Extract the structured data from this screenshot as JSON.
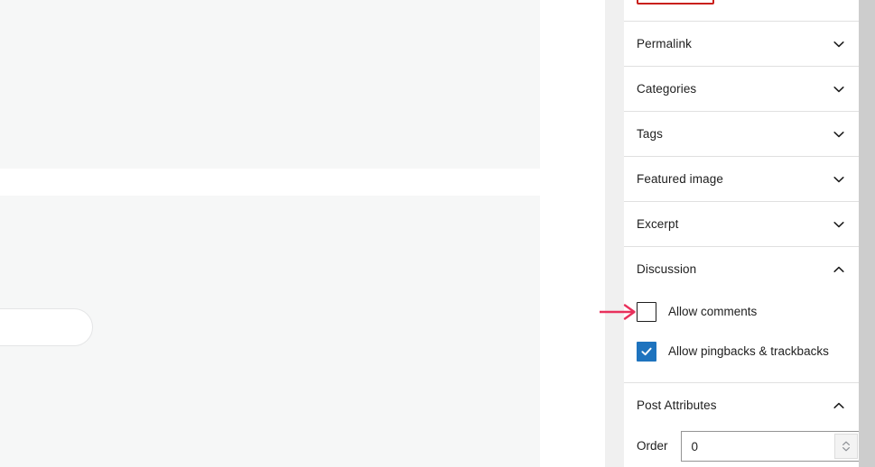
{
  "editor": {
    "canvas_blocks": [
      "content-placeholder-top",
      "content-placeholder-bottom"
    ],
    "pill_element": ""
  },
  "sidebar": {
    "highlighted_button_label": "",
    "sections": [
      {
        "label": "Permalink",
        "expanded": false,
        "icon": "chevron-down-icon"
      },
      {
        "label": "Categories",
        "expanded": false,
        "icon": "chevron-down-icon"
      },
      {
        "label": "Tags",
        "expanded": false,
        "icon": "chevron-down-icon"
      },
      {
        "label": "Featured image",
        "expanded": false,
        "icon": "chevron-down-icon"
      },
      {
        "label": "Excerpt",
        "expanded": false,
        "icon": "chevron-down-icon"
      },
      {
        "label": "Discussion",
        "expanded": true,
        "icon": "chevron-up-icon"
      },
      {
        "label": "Post Attributes",
        "expanded": true,
        "icon": "chevron-up-icon"
      }
    ],
    "discussion": {
      "checkboxes": [
        {
          "label": "Allow comments",
          "checked": false
        },
        {
          "label": "Allow pingbacks & trackbacks",
          "checked": true
        }
      ]
    },
    "post_attributes": {
      "order_label": "Order",
      "order_value": "0",
      "order_placeholder": "0",
      "spinner_icon": "spinner-arrows-icon"
    }
  },
  "annotation": {
    "arrow_icon": "red-arrow-right-icon",
    "arrow_target": "allow-comments-checkbox",
    "arrow_color": "#e8315c",
    "box_color": "#c9201b"
  },
  "colors": {
    "accent_blue": "#1e73be",
    "panel_bg": "#ffffff",
    "canvas_block": "#f6f7f7",
    "divider": "#e0e0e0",
    "gutter": "#f0f0f0",
    "scrollbar": "#cdcdcd",
    "text": "#1e1e1e"
  },
  "scrollbar": {
    "name": "vertical-scrollbar"
  }
}
